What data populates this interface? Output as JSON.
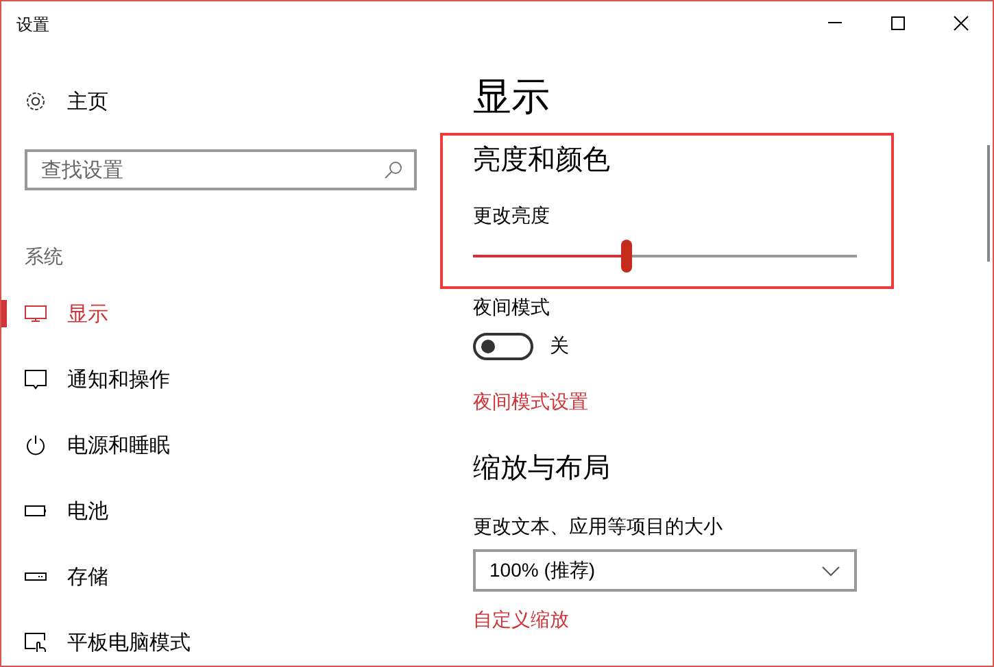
{
  "window": {
    "title": "设置"
  },
  "sidebar": {
    "home": {
      "label": "主页"
    },
    "search": {
      "placeholder": "查找设置"
    },
    "section": "系统",
    "items": [
      {
        "label": "显示",
        "selected": true
      },
      {
        "label": "通知和操作",
        "selected": false
      },
      {
        "label": "电源和睡眠",
        "selected": false
      },
      {
        "label": "电池",
        "selected": false
      },
      {
        "label": "存储",
        "selected": false
      },
      {
        "label": "平板电脑模式",
        "selected": false
      }
    ]
  },
  "page": {
    "title": "显示",
    "brightness": {
      "heading": "亮度和颜色",
      "label": "更改亮度",
      "level": 0.4
    },
    "night_light": {
      "label": "夜间模式",
      "on": false,
      "state": "关",
      "link": "夜间模式设置"
    },
    "scale": {
      "heading": "缩放与布局",
      "label": "更改文本、应用等项目的大小",
      "value": "100% (推荐)",
      "link": "自定义缩放"
    }
  }
}
